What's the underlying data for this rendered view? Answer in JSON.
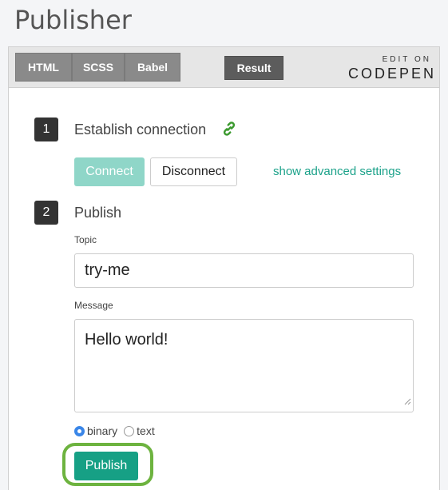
{
  "page": {
    "title": "Publisher"
  },
  "codepen": {
    "tabs": [
      "HTML",
      "SCSS",
      "Babel"
    ],
    "result_tab": "Result",
    "edit_on": "EDIT ON",
    "brand": "CODEPEN"
  },
  "step1": {
    "number": "1",
    "title": "Establish connection",
    "connect_label": "Connect",
    "disconnect_label": "Disconnect",
    "advanced_link": "show advanced settings",
    "connect_color": "#8fd6c8",
    "link_icon_color": "#3c9a2f"
  },
  "step2": {
    "number": "2",
    "title": "Publish",
    "topic_label": "Topic",
    "topic_value": "try-me",
    "message_label": "Message",
    "message_value": "Hello world!",
    "format_options": [
      "binary",
      "text"
    ],
    "format_selected": "binary",
    "publish_label": "Publish",
    "publish_color": "#16a085",
    "highlight_color": "#6db33f"
  }
}
